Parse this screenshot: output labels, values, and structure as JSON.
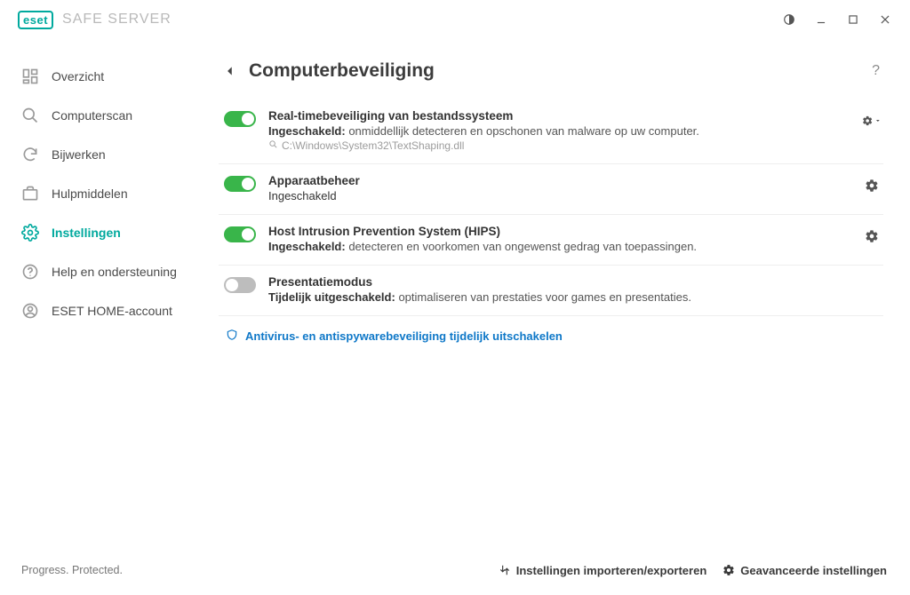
{
  "app": {
    "brand": "eset",
    "title": "SAFE SERVER"
  },
  "sidebar": {
    "items": [
      {
        "label": "Overzicht"
      },
      {
        "label": "Computerscan"
      },
      {
        "label": "Bijwerken"
      },
      {
        "label": "Hulpmiddelen"
      },
      {
        "label": "Instellingen"
      },
      {
        "label": "Help en ondersteuning"
      },
      {
        "label": "ESET HOME-account"
      }
    ]
  },
  "page": {
    "title": "Computerbeveiliging"
  },
  "settings": [
    {
      "title": "Real-timebeveiliging van bestandssysteem",
      "status_label": "Ingeschakeld:",
      "desc": "onmiddellijk detecteren en opschonen van malware op uw computer.",
      "path": "C:\\Windows\\System32\\TextShaping.dll",
      "on": true
    },
    {
      "title": "Apparaatbeheer",
      "status_label": "Ingeschakeld",
      "desc": "",
      "on": true
    },
    {
      "title": "Host Intrusion Prevention System (HIPS)",
      "status_label": "Ingeschakeld:",
      "desc": "detecteren en voorkomen van ongewenst gedrag van toepassingen.",
      "on": true
    },
    {
      "title": "Presentatiemodus",
      "status_label": "Tijdelijk uitgeschakeld:",
      "desc": "optimaliseren van prestaties voor games en presentaties.",
      "on": false
    }
  ],
  "link": {
    "label": "Antivirus- en antispywarebeveiliging tijdelijk uitschakelen"
  },
  "footer": {
    "tagline": "Progress. Protected.",
    "import_export": "Instellingen importeren/exporteren",
    "advanced": "Geavanceerde instellingen"
  }
}
